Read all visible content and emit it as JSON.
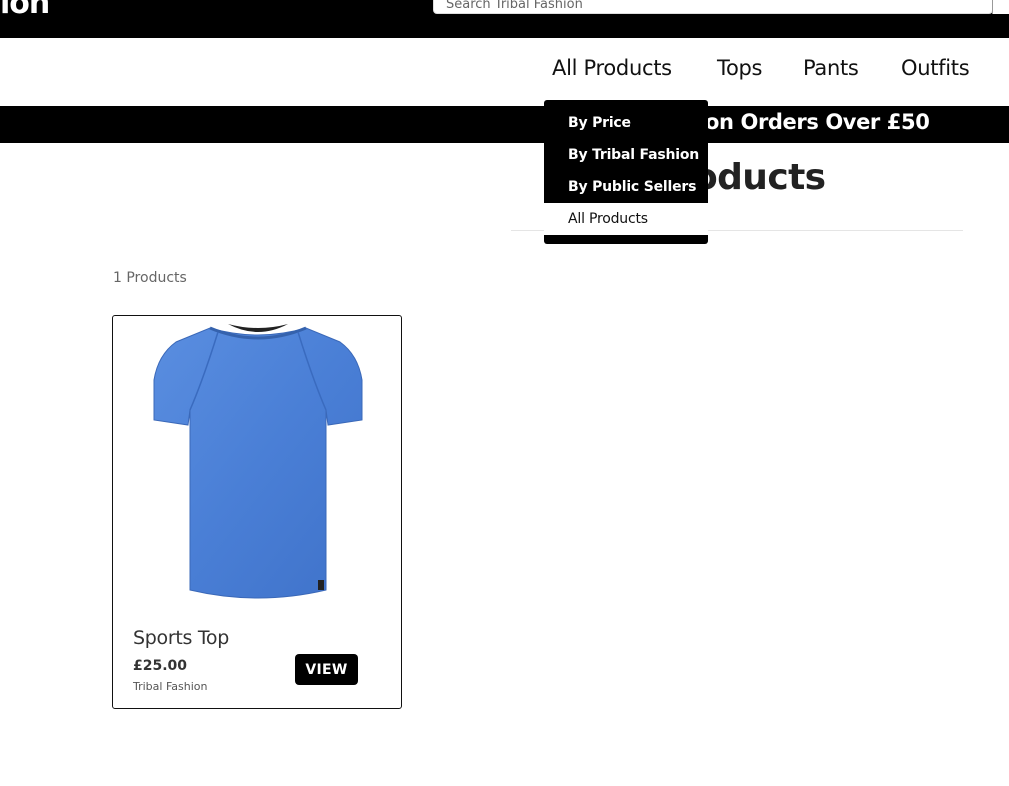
{
  "header": {
    "logo_fragment": "ion",
    "search": {
      "placeholder": "Search Tribal Fashion",
      "value": ""
    }
  },
  "nav": {
    "items": [
      {
        "label": "All Products"
      },
      {
        "label": "Tops"
      },
      {
        "label": "Pants"
      },
      {
        "label": "Outfits"
      }
    ],
    "dropdown": {
      "items": [
        {
          "label": "By Price"
        },
        {
          "label": "By Tribal Fashion"
        },
        {
          "label": "By Public Sellers"
        },
        {
          "label": "All Products",
          "active": true
        }
      ]
    }
  },
  "promo": {
    "text": "on Orders Over £50"
  },
  "page": {
    "title_fragment": "oducts",
    "product_count": "1 Products"
  },
  "products": [
    {
      "name": "Sports Top",
      "price": "£25.00",
      "seller": "Tribal Fashion",
      "view_label": "VIEW",
      "image": {
        "icon": "blue-tshirt-image",
        "color": "#4a7fd6"
      }
    }
  ],
  "colors": {
    "bars": "#000000",
    "accent": "#000000",
    "text": "#222222"
  }
}
